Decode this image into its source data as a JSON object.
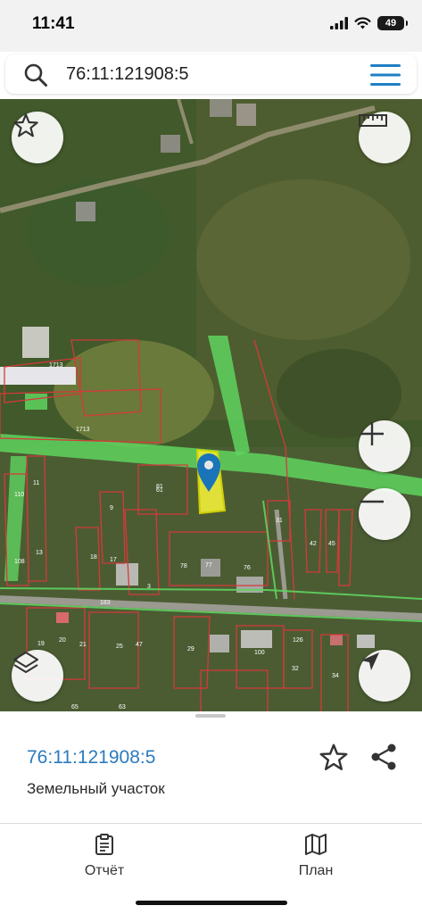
{
  "status": {
    "time": "11:41",
    "battery": "49"
  },
  "search": {
    "query": "76:11:121908:5"
  },
  "map": {
    "labels": [
      "1713",
      "1713",
      "110",
      "61",
      "9",
      "31",
      "42",
      "45",
      "108",
      "13",
      "18",
      "17",
      "78",
      "77",
      "76",
      "3",
      "183",
      "19",
      "20",
      "21",
      "25",
      "47",
      "29",
      "100",
      "126",
      "32",
      "34",
      "11",
      "65",
      "63",
      "81"
    ]
  },
  "sheet": {
    "parcel_id": "76:11:121908:5",
    "parcel_type": "Земельный участок"
  },
  "tabs": [
    {
      "label": "Отчёт"
    },
    {
      "label": "План"
    }
  ],
  "colors": {
    "accent": "#2b7bbf",
    "highlight": "#e8e83a",
    "zone": "#5fd35f"
  }
}
